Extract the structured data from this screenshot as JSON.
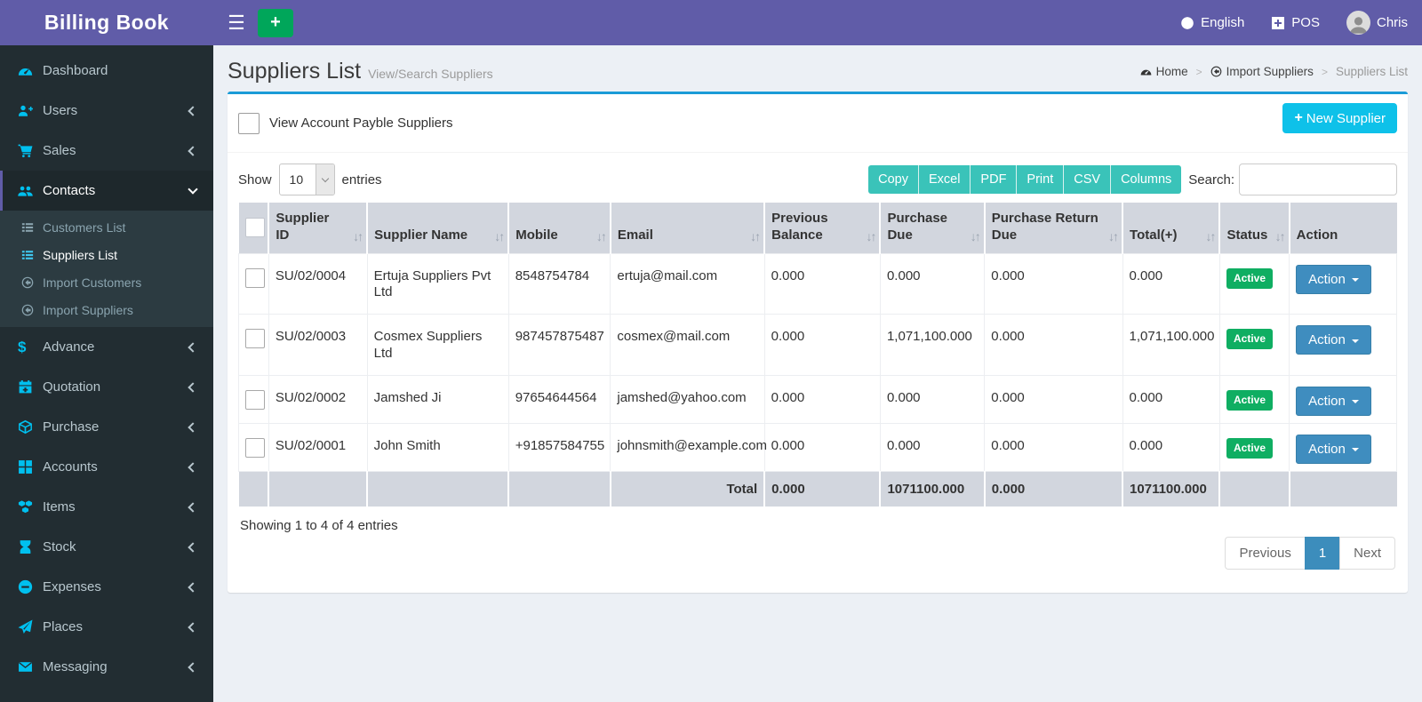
{
  "brand": {
    "title": "Billing Book"
  },
  "navbar": {
    "language": "English",
    "pos": "POS",
    "user": "Chris"
  },
  "sidebar": {
    "items": [
      {
        "label": "Dashboard",
        "icon": "dashboard-icon"
      },
      {
        "label": "Users",
        "icon": "user-plus-icon",
        "chevron": true
      },
      {
        "label": "Sales",
        "icon": "cart-icon",
        "chevron": true
      },
      {
        "label": "Contacts",
        "icon": "people-icon",
        "chevron": true,
        "expanded": true,
        "active": true,
        "children": [
          {
            "label": "Customers List",
            "icon": "list-icon"
          },
          {
            "label": "Suppliers List",
            "icon": "list-icon",
            "active": true
          },
          {
            "label": "Import Customers",
            "icon": "import-icon"
          },
          {
            "label": "Import Suppliers",
            "icon": "import-icon"
          }
        ]
      },
      {
        "label": "Advance",
        "icon": "dollar-icon",
        "chevron": true
      },
      {
        "label": "Quotation",
        "icon": "calendar-plus-icon",
        "chevron": true
      },
      {
        "label": "Purchase",
        "icon": "cube-icon",
        "chevron": true
      },
      {
        "label": "Accounts",
        "icon": "grid-icon",
        "chevron": true
      },
      {
        "label": "Items",
        "icon": "cubes-icon",
        "chevron": true
      },
      {
        "label": "Stock",
        "icon": "hourglass-icon",
        "chevron": true
      },
      {
        "label": "Expenses",
        "icon": "minus-circle-icon",
        "chevron": true
      },
      {
        "label": "Places",
        "icon": "paper-plane-icon",
        "chevron": true
      },
      {
        "label": "Messaging",
        "icon": "envelope-icon",
        "chevron": true
      }
    ]
  },
  "page": {
    "title": "Suppliers List",
    "subtitle": "View/Search Suppliers",
    "breadcrumb": [
      {
        "label": "Home",
        "icon": "dashboard-icon"
      },
      {
        "label": "Import Suppliers",
        "icon": "import-icon"
      },
      {
        "label": "Suppliers List"
      }
    ]
  },
  "panel": {
    "filter_label": "View Account Payble Suppliers",
    "new_supplier_label": "New Supplier",
    "show_label": "Show",
    "entries_label": "entries",
    "page_length": "10",
    "export_buttons": [
      "Copy",
      "Excel",
      "PDF",
      "Print",
      "CSV",
      "Columns"
    ],
    "search_label": "Search:",
    "search_value": "",
    "info": "Showing 1 to 4 of 4 entries",
    "pagination": {
      "prev": "Previous",
      "pages": [
        "1"
      ],
      "active": "1",
      "next": "Next"
    }
  },
  "table": {
    "columns": [
      "",
      "Supplier ID",
      "Supplier Name",
      "Mobile",
      "Email",
      "Previous Balance",
      "Purchase Due",
      "Purchase Return Due",
      "Total(+)",
      "Status",
      "Action"
    ],
    "sortable": [
      false,
      true,
      true,
      true,
      true,
      true,
      true,
      true,
      true,
      true,
      false
    ],
    "col_widths": [
      "2.6%",
      "8.5%",
      "12.21%",
      "8.8%",
      "13.3%",
      "10.0%",
      "9.0%",
      "11.92%",
      "8.4%",
      "6.0%",
      "9.27%"
    ],
    "rows": [
      {
        "id": "SU/02/0004",
        "name": "Ertuja Suppliers Pvt Ltd",
        "mobile": "8548754784",
        "email": "ertuja@mail.com",
        "previous_balance": "0.000",
        "purchase_due": "0.000",
        "purchase_return_due": "0.000",
        "total": "0.000",
        "status": "Active",
        "action": "Action"
      },
      {
        "id": "SU/02/0003",
        "name": "Cosmex Suppliers Ltd",
        "mobile": "987457875487",
        "email": "cosmex@mail.com",
        "previous_balance": "0.000",
        "purchase_due": "1,071,100.000",
        "purchase_return_due": "0.000",
        "total": "1,071,100.000",
        "status": "Active",
        "action": "Action"
      },
      {
        "id": "SU/02/0002",
        "name": "Jamshed Ji",
        "mobile": "97654644564",
        "email": "jamshed@yahoo.com",
        "previous_balance": "0.000",
        "purchase_due": "0.000",
        "purchase_return_due": "0.000",
        "total": "0.000",
        "status": "Active",
        "action": "Action"
      },
      {
        "id": "SU/02/0001",
        "name": "John Smith",
        "mobile": "+91857584755",
        "email": "johnsmith@example.com",
        "previous_balance": "0.000",
        "purchase_due": "0.000",
        "purchase_return_due": "0.000",
        "total": "0.000",
        "status": "Active",
        "action": "Action"
      }
    ],
    "footer": {
      "label": "Total",
      "previous_balance": "0.000",
      "purchase_due": "1071100.000",
      "purchase_return_due": "0.000",
      "total": "1071100.000"
    }
  },
  "colors": {
    "navbar": "#605ca8",
    "sidebar": "#222d32",
    "sidebar_active_bg": "#1e282c",
    "sidebar_icon": "#00c0ef",
    "card_top_border": "#1a9bd7",
    "new_button": "#0ec1e9",
    "export_button": "#3ac3b9",
    "table_header_bg": "#d2d6de",
    "status_active": "#0fae62",
    "action_button": "#3f8dbf",
    "pagination_active": "#3c8dbc",
    "add_button": "#00a65a",
    "content_bg": "#ecf0f5"
  }
}
